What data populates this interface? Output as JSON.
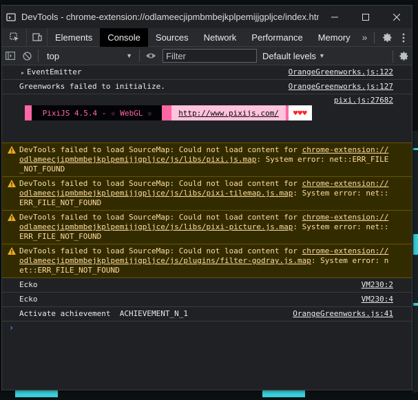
{
  "window": {
    "title": "DevTools - chrome-extension://odlameecjipmbmbejkplpemijjgpljce/index.html"
  },
  "tabs": [
    {
      "label": "Elements",
      "active": false
    },
    {
      "label": "Console",
      "active": true
    },
    {
      "label": "Sources",
      "active": false
    },
    {
      "label": "Network",
      "active": false
    },
    {
      "label": "Performance",
      "active": false
    },
    {
      "label": "Memory",
      "active": false
    }
  ],
  "tabs_more": "»",
  "toolbar": {
    "context": "top",
    "filter_placeholder": "Filter",
    "levels": "Default levels"
  },
  "console": {
    "rows_top": [
      {
        "msg": "EventEmitter",
        "src": "OrangeGreenworks.js:122",
        "expandable": true
      },
      {
        "msg": "Greenworks failed to initialize.",
        "src": "OrangeGreenworks.js:127",
        "expandable": false
      }
    ],
    "pixi": {
      "src": "pixi.js:27682",
      "text": " PixiJS 4.5.4 - ☆ WebGL ☆ ",
      "url": "http://www.pixijs.com/",
      "hearts": "♥♥♥"
    },
    "warnings": [
      {
        "prefix": "DevTools failed to load SourceMap: Could not load content for ",
        "link": "chrome-extension://odlameecjipmbmbejkplpemijjgpljce/js/libs/pixi.js.map",
        "suffix": ": System error: net::ERR_FILE_NOT_FOUND"
      },
      {
        "prefix": "DevTools failed to load SourceMap: Could not load content for ",
        "link": "chrome-extension://odlameecjipmbmbejkplpemijjgpljce/js/libs/pixi-tilemap.js.map",
        "suffix": ": System error: net::ERR_FILE_NOT_FOUND"
      },
      {
        "prefix": "DevTools failed to load SourceMap: Could not load content for ",
        "link": "chrome-extension://odlameecjipmbmbejkplpemijjgpljce/js/libs/pixi-picture.js.map",
        "suffix": ": System error: net::ERR_FILE_NOT_FOUND"
      },
      {
        "prefix": "DevTools failed to load SourceMap: Could not load content for ",
        "link": "chrome-extension://odlameecjipmbmbejkplpemijjgpljce/js/plugins/filter-godray.js.map",
        "suffix": ": System error: net::ERR_FILE_NOT_FOUND"
      }
    ],
    "rows_bottom": [
      {
        "msg": "Ecko",
        "src": "VM230:2"
      },
      {
        "msg": "Ecko",
        "src": "VM230:4"
      },
      {
        "msg": "Activate achievement  ACHIEVEMENT_N_1",
        "src": "OrangeGreenworks.js:41"
      }
    ],
    "prompt": "›"
  },
  "colors": {
    "warning_bg": "#332b00",
    "warning_text": "#ffdd9e",
    "pixi_pink": "#ff66a5",
    "prompt_blue": "#4e9cf4"
  }
}
